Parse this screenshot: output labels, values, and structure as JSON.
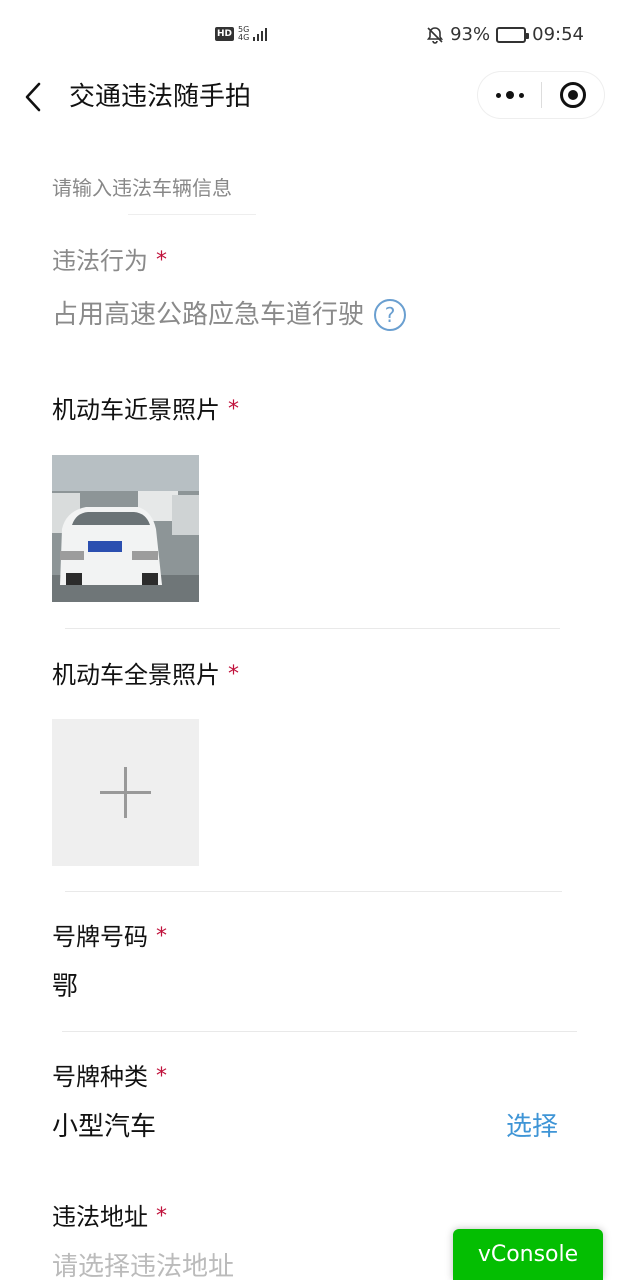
{
  "status_bar": {
    "hd_badge": "HD",
    "network_type_top": "5G",
    "network_type_bottom": "4G",
    "battery_percent": "93%",
    "battery_level": 0.93,
    "time": "09:54",
    "icons": [
      "hd-icon",
      "signal-icon",
      "mute-bell-icon",
      "battery-icon"
    ]
  },
  "nav": {
    "title": "交通违法随手拍",
    "icons": [
      "back-chevron-icon",
      "more-dots-icon",
      "close-target-icon"
    ]
  },
  "form": {
    "vehicle_info_placeholder": "请输入违法车辆信息",
    "behavior": {
      "label": "违法行为",
      "required_mark": "*",
      "value": "占用高速公路应急车道行驶",
      "help_icon": "?"
    },
    "closeup_photo": {
      "label": "机动车近景照片",
      "required_mark": "*"
    },
    "panorama_photo": {
      "label": "机动车全景照片",
      "required_mark": "*",
      "upload_icon": "plus-icon"
    },
    "plate_number": {
      "label": "号牌号码",
      "required_mark": "*",
      "value": "鄂"
    },
    "plate_type": {
      "label": "号牌种类",
      "required_mark": "*",
      "value": "小型汽车",
      "action": "选择"
    },
    "address": {
      "label": "违法地址",
      "required_mark": "*",
      "placeholder": "请选择违法地址"
    }
  },
  "vconsole": {
    "label": "vConsole",
    "color": "#04be02"
  },
  "colors": {
    "required": "#c0123c",
    "link": "#3f95d6"
  }
}
